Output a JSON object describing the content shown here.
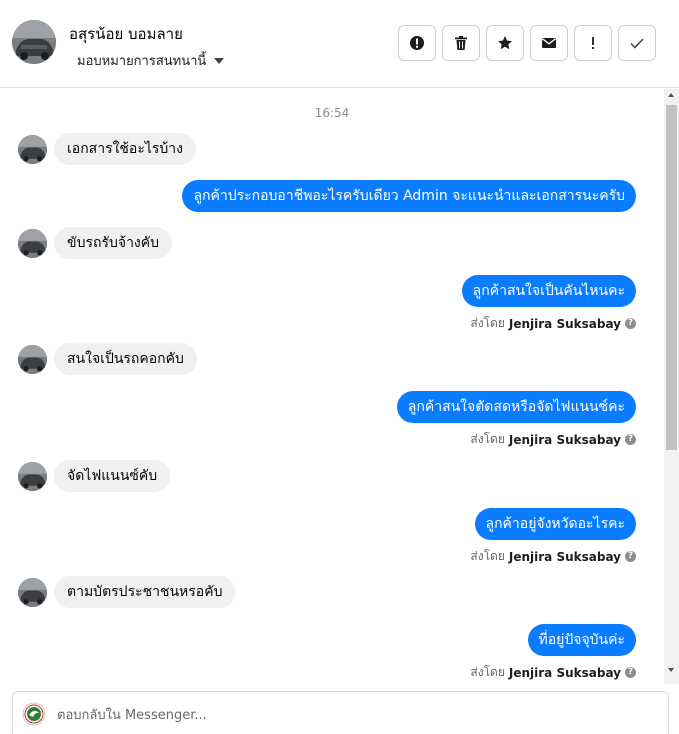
{
  "header": {
    "contact_name": "อสุรน้อย บอมลาย",
    "assign_label": "มอบหมายการสนทนานี้"
  },
  "toolbar": {
    "icons": [
      "alert-circle-icon",
      "trash-icon",
      "star-icon",
      "envelope-icon",
      "exclamation-icon",
      "check-icon"
    ]
  },
  "thread": {
    "timestamp": "16:54",
    "messages": [
      {
        "direction": "in",
        "text": "เอกสารใช้อะไรบ้าง"
      },
      {
        "direction": "out",
        "text": "ลูกค้าประกอบอาชีพอะไรครับเดียว Admin จะแนะนำและเอกสารนะครับ"
      },
      {
        "direction": "in",
        "text": "ขับรถรับจ้างคับ"
      },
      {
        "direction": "out",
        "text": "ลูกค้าสนใจเป็นคันไหนคะ",
        "sent_by_prefix": "ส่งโดย",
        "sender": "Jenjira Suksabay"
      },
      {
        "direction": "in",
        "text": "สนใจเป็นรถคอกคับ"
      },
      {
        "direction": "out",
        "text": "ลูกค้าสนใจตัดสดหรือจัดไฟแนนซ์คะ",
        "sent_by_prefix": "ส่งโดย",
        "sender": "Jenjira Suksabay"
      },
      {
        "direction": "in",
        "text": "จัดไฟแนนซ์คับ"
      },
      {
        "direction": "out",
        "text": "ลูกค้าอยู่จังหวัดอะไรคะ",
        "sent_by_prefix": "ส่งโดย",
        "sender": "Jenjira Suksabay"
      },
      {
        "direction": "in",
        "text": "ตามบัตรประชาชนหรอคับ"
      },
      {
        "direction": "out",
        "text": "ที่อยู่ปัจจุบันค่ะ",
        "sent_by_prefix": "ส่งโดย",
        "sender": "Jenjira Suksabay"
      }
    ]
  },
  "composer": {
    "placeholder": "ตอบกลับใน Messenger..."
  },
  "colors": {
    "outgoing_bubble": "#0a7cff",
    "incoming_bubble": "#f0f0f0"
  }
}
